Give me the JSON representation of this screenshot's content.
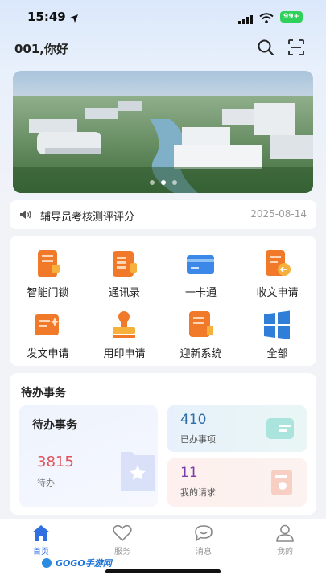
{
  "status_bar": {
    "time": "15:49",
    "battery": "99+",
    "location_icon": "location-arrow-icon",
    "signal_icon": "signal-icon",
    "wifi_icon": "wifi-icon"
  },
  "header": {
    "greeting": "001,你好",
    "search_icon": "search-icon",
    "scan_icon": "scan-icon"
  },
  "banner": {
    "image": "campus-aerial-photo",
    "dots_total": 3,
    "active_dot": 2
  },
  "notice": {
    "icon": "speaker-icon",
    "text": "辅导员考核测评评分",
    "date": "2025-08-14"
  },
  "apps": [
    {
      "label": "智能门锁",
      "icon": "smart-lock-icon"
    },
    {
      "label": "通讯录",
      "icon": "contacts-icon"
    },
    {
      "label": "一卡通",
      "icon": "card-icon"
    },
    {
      "label": "收文申请",
      "icon": "incoming-doc-icon"
    },
    {
      "label": "发文申请",
      "icon": "outgoing-doc-icon"
    },
    {
      "label": "用印申请",
      "icon": "seal-icon"
    },
    {
      "label": "迎新系统",
      "icon": "welcome-system-icon"
    },
    {
      "label": "全部",
      "icon": "all-apps-icon"
    }
  ],
  "todo": {
    "section_title": "待办事务",
    "main": {
      "title": "待办事务",
      "count": "3815",
      "label": "待办"
    },
    "done": {
      "count": "410",
      "label": "已办事项"
    },
    "requests": {
      "count": "11",
      "label": "我的请求"
    }
  },
  "tabbar": [
    {
      "label": "首页",
      "icon": "home-icon",
      "active": true
    },
    {
      "label": "服务",
      "icon": "heart-icon",
      "active": false
    },
    {
      "label": "消息",
      "icon": "message-icon",
      "active": false
    },
    {
      "label": "我的",
      "icon": "profile-icon",
      "active": false
    }
  ],
  "watermark": {
    "text": "GOGO手游网"
  },
  "colors": {
    "accent": "#2f6fe0",
    "orange": "#f07a2a",
    "pending_red": "#e0515a",
    "done_blue": "#2e6ea8",
    "request_purple": "#7a3ea8"
  }
}
